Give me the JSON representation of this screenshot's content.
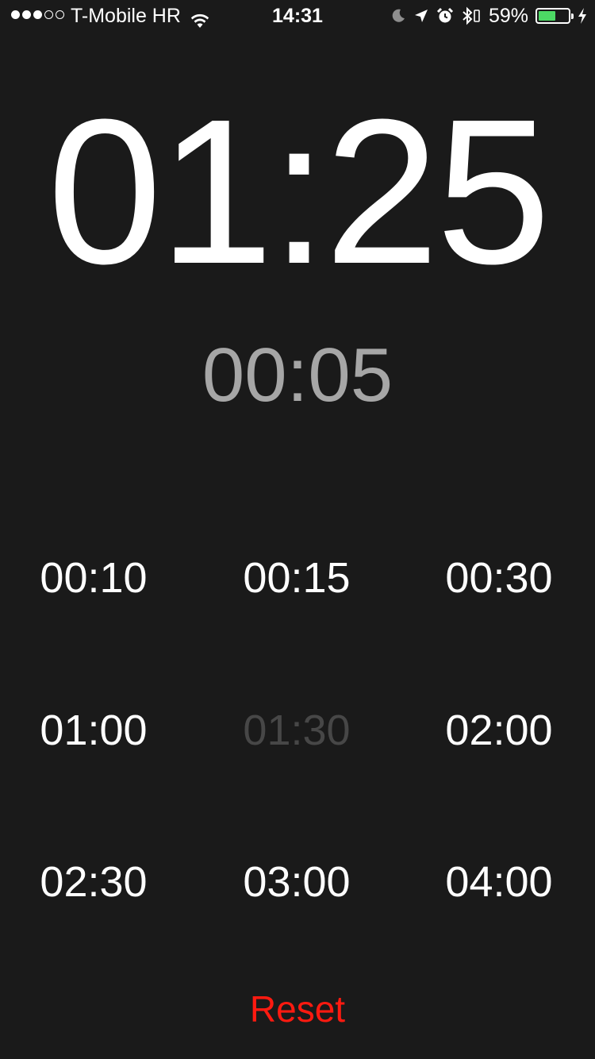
{
  "status_bar": {
    "signal_bars_filled": 3,
    "signal_bars_total": 5,
    "carrier": "T-Mobile HR",
    "wifi_icon": "wifi-icon",
    "time": "14:31",
    "icons": [
      "moon-icon",
      "location-arrow-icon",
      "alarm-icon",
      "bluetooth-icon"
    ],
    "battery_percent": "59%",
    "battery_level": 0.59,
    "battery_color": "#4cd964",
    "charging_icon": "bolt-icon"
  },
  "timer": {
    "main": "01:25",
    "sub": "00:05"
  },
  "presets": [
    {
      "label": "00:10",
      "enabled": true
    },
    {
      "label": "00:15",
      "enabled": true
    },
    {
      "label": "00:30",
      "enabled": true
    },
    {
      "label": "01:00",
      "enabled": true
    },
    {
      "label": "01:30",
      "enabled": false
    },
    {
      "label": "02:00",
      "enabled": true
    },
    {
      "label": "02:30",
      "enabled": true
    },
    {
      "label": "03:00",
      "enabled": true
    },
    {
      "label": "04:00",
      "enabled": true
    }
  ],
  "reset_label": "Reset",
  "colors": {
    "background": "#1a1a1a",
    "reset": "#ff1a10",
    "sub_time": "#a6a6a6",
    "disabled": "#474747"
  }
}
